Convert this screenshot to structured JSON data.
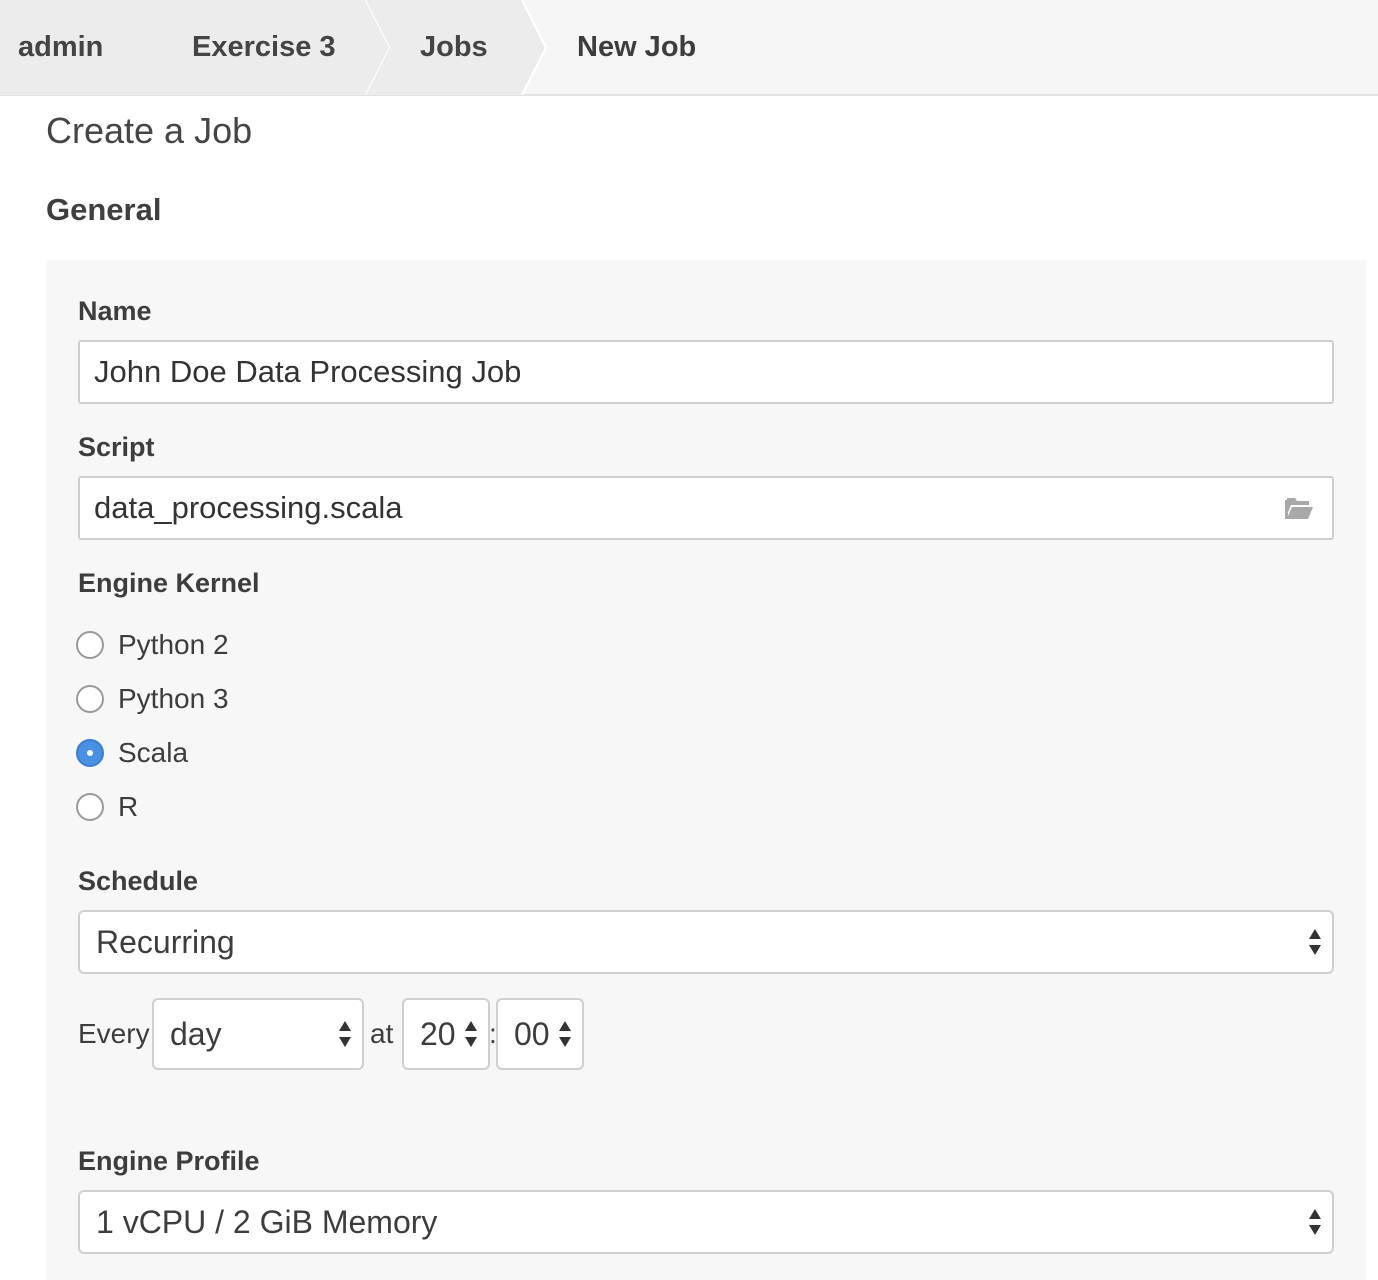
{
  "breadcrumb": {
    "items": [
      {
        "label": "admin"
      },
      {
        "label": "Exercise 3"
      },
      {
        "label": "Jobs"
      },
      {
        "label": "New Job"
      }
    ]
  },
  "page": {
    "title": "Create a Job",
    "section_title": "General"
  },
  "form": {
    "name": {
      "label": "Name",
      "value": "John Doe Data Processing Job"
    },
    "script": {
      "label": "Script",
      "value": "data_processing.scala",
      "icon": "folder-open-icon"
    },
    "engine_kernel": {
      "label": "Engine Kernel",
      "options": [
        {
          "label": "Python 2",
          "checked": false
        },
        {
          "label": "Python 3",
          "checked": false
        },
        {
          "label": "Scala",
          "checked": true
        },
        {
          "label": "R",
          "checked": false
        }
      ]
    },
    "schedule": {
      "label": "Schedule",
      "value": "Recurring",
      "every_label": "Every",
      "period_value": "day",
      "at_label": "at",
      "hour_value": "20",
      "separator": ":",
      "minute_value": "00"
    },
    "engine_profile": {
      "label": "Engine Profile",
      "value": "1 vCPU / 2 GiB Memory"
    }
  },
  "colors": {
    "accent": "#4a90e2",
    "panel_bg": "#f7f7f7",
    "breadcrumb_bg": "#ececec"
  }
}
